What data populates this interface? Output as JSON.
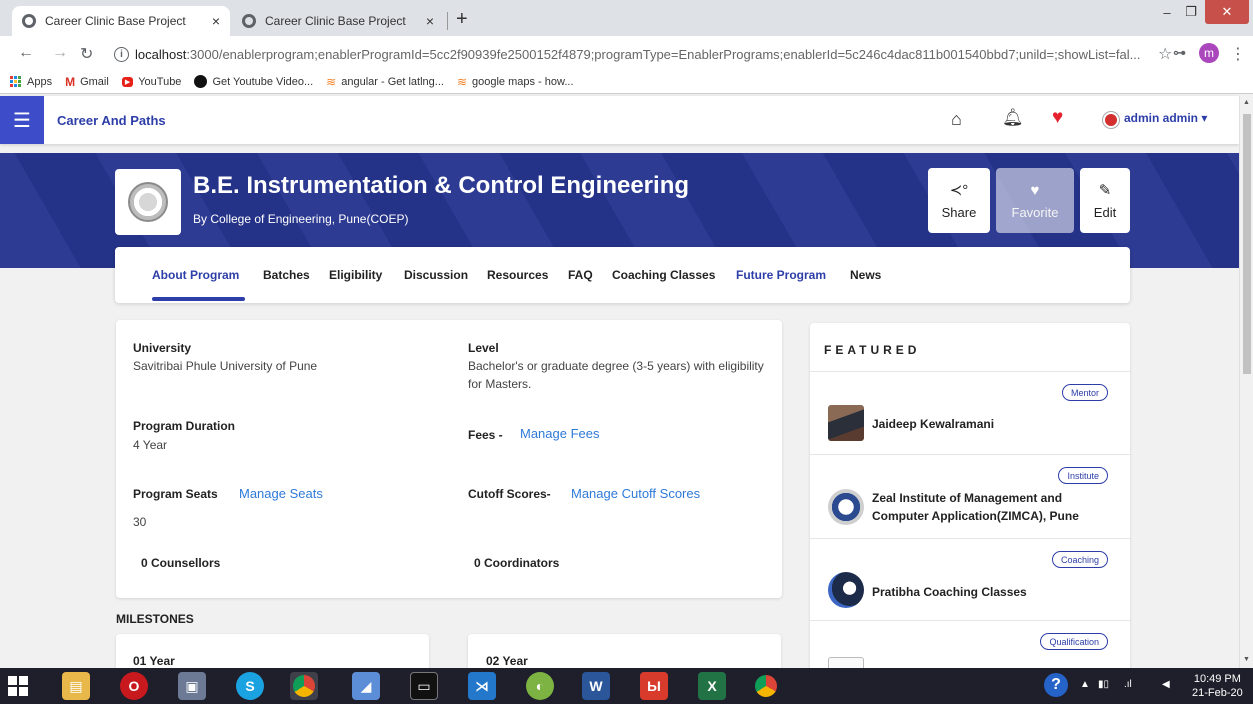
{
  "browser": {
    "tabs": [
      {
        "title": "Career Clinic Base Project",
        "close": "×"
      },
      {
        "title": "Career Clinic Base Project",
        "close": "×"
      }
    ],
    "new_tab": "+",
    "url_host": "localhost",
    "url_rest": ":3000/enablerprogram;enablerProgramId=5cc2f90939fe2500152f4879;programType=EnablerPrograms;enablerId=5c246c4dac811b001540bbd7;unild=;showList=fal...",
    "profile_initial": "m",
    "bookmarks": [
      "Apps",
      "Gmail",
      "YouTube",
      "Get Youtube Video...",
      "angular - Get latlng...",
      "google maps - how..."
    ]
  },
  "app": {
    "brand": "Career And Paths",
    "user": "admin admin ▾"
  },
  "program": {
    "title": "B.E. Instrumentation & Control Engineering",
    "by": "By College of Engineering, Pune(COEP)",
    "actions": {
      "share": "Share",
      "favorite": "Favorite",
      "edit": "Edit"
    },
    "tabs": [
      "About Program",
      "Batches",
      "Eligibility",
      "Discussion",
      "Resources",
      "FAQ",
      "Coaching Classes",
      "Future Program",
      "News"
    ]
  },
  "about": {
    "university_label": "University",
    "university_value": "Savitribai Phule University of Pune",
    "level_label": "Level",
    "level_value": "Bachelor's or graduate degree (3-5 years) with eligibility for Masters.",
    "duration_label": "Program Duration",
    "duration_value": "4 Year",
    "fees_label": "Fees -",
    "fees_link": "Manage Fees",
    "seats_label": "Program Seats",
    "seats_link": "Manage Seats",
    "seats_value": "30",
    "cutoff_label": "Cutoff Scores-",
    "cutoff_link": "Manage Cutoff Scores",
    "counsellors": "0 Counsellors",
    "coordinators": "0 Coordinators"
  },
  "milestones": {
    "heading": "MILESTONES",
    "years": [
      "01 Year",
      "02 Year"
    ]
  },
  "featured": {
    "title": "FEATURED",
    "items": [
      {
        "tag": "Mentor",
        "name": "Jaideep Kewalramani"
      },
      {
        "tag": "Institute",
        "name": "Zeal Institute of Management and Computer Application(ZIMCA), Pune"
      },
      {
        "tag": "Coaching",
        "name": "Pratibha Coaching Classes"
      },
      {
        "tag": "Qualification",
        "name": ""
      }
    ]
  },
  "taskbar": {
    "time": "10:49 PM",
    "date": "21-Feb-20"
  }
}
